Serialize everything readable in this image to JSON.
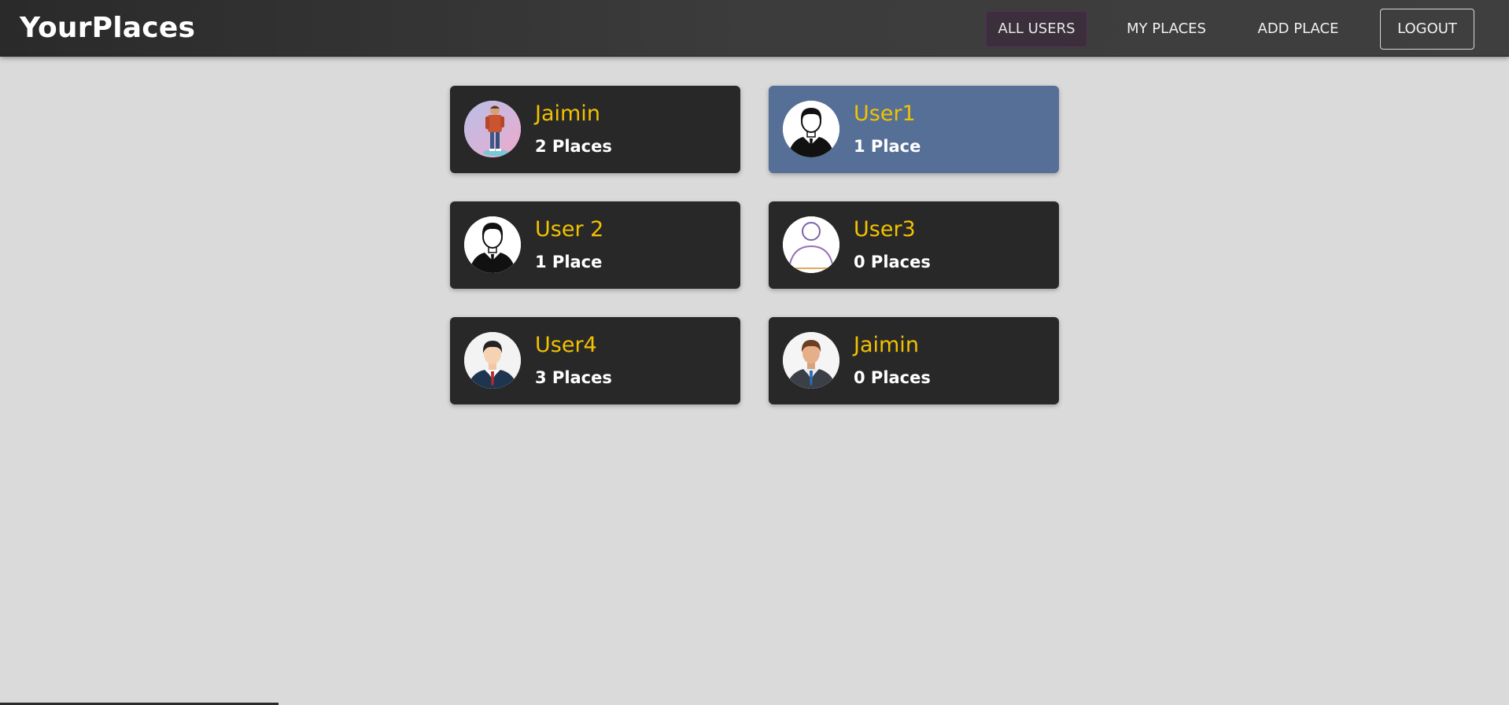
{
  "header": {
    "logo": "YourPlaces",
    "nav": {
      "all_users": "ALL USERS",
      "my_places": "MY PLACES",
      "add_place": "ADD PLACE",
      "logout": "LOGOUT"
    }
  },
  "colors": {
    "header_bg": "#3c3c3c",
    "card_bg": "#282828",
    "card_active_bg": "#566f96",
    "name_color": "#f2c200",
    "page_bg": "#dadada"
  },
  "users": [
    {
      "name": "Jaimin",
      "places": "2 Places",
      "avatar": "gamer-photo-avatar",
      "active": false
    },
    {
      "name": "User1",
      "places": "1 Place",
      "avatar": "businessman-silhouette-avatar",
      "active": true
    },
    {
      "name": "User 2",
      "places": "1 Place",
      "avatar": "businessman-silhouette-avatar",
      "active": false
    },
    {
      "name": "User3",
      "places": "0 Places",
      "avatar": "outline-person-avatar",
      "active": false
    },
    {
      "name": "User4",
      "places": "3 Places",
      "avatar": "businessman-cartoon-avatar",
      "active": false
    },
    {
      "name": "Jaimin",
      "places": "0 Places",
      "avatar": "businessman-blue-suit-avatar",
      "active": false
    }
  ]
}
